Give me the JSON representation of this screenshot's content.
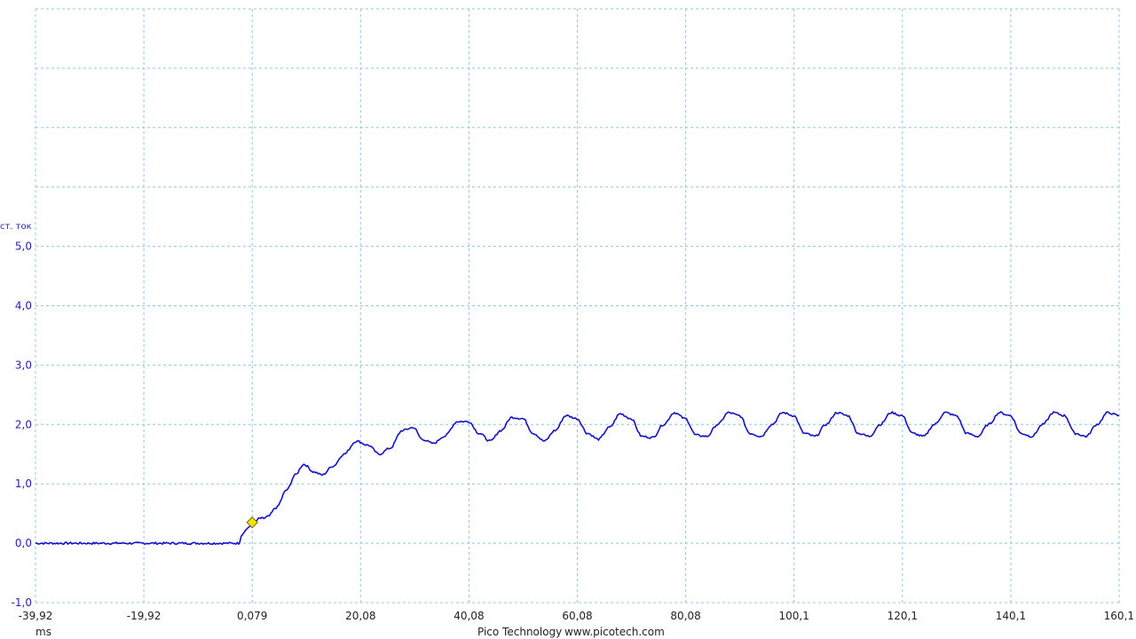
{
  "chart_data": {
    "type": "line",
    "x_unit": "ms",
    "y_label": "ст. ток",
    "x_ticks": [
      "-39,92",
      "-19,92",
      "0,079",
      "20,08",
      "40,08",
      "60,08",
      "80,08",
      "100,1",
      "120,1",
      "140,1",
      "160,1"
    ],
    "y_ticks": [
      "5,0",
      "4,0",
      "3,0",
      "2,0",
      "1,0",
      "0,0",
      "-1,0"
    ],
    "xlim": [
      -39.92,
      160.1
    ],
    "ylim": [
      -1.0,
      9.0
    ],
    "grid": true,
    "trigger_marker": {
      "x": 0.079,
      "y": 0.35
    },
    "series": [
      {
        "color": "#1212c8",
        "x": [
          -39.92,
          -25,
          -10,
          -2.4,
          -1.8,
          -0.8,
          0.4,
          1.5,
          2.2,
          3.0,
          4.5,
          6.5,
          8.0,
          9.6,
          11.5,
          13.0,
          15.0,
          17.0,
          19.3,
          21.5,
          23.5,
          25.5,
          27.8,
          29.8,
          31.5,
          33.5,
          35.5,
          38.0,
          40.0,
          42.0,
          44.0,
          46.0,
          48.0,
          50.0,
          52.0,
          54.0,
          56.0,
          58.0,
          60.0,
          62.0,
          64.0,
          66.0,
          68.0,
          70.0,
          72.0,
          74.0,
          76.0,
          78.0,
          80.0,
          82.0,
          84.0,
          86.0,
          88.0,
          90.0,
          92.0,
          94.0,
          96.0,
          98.0,
          100.0,
          102.0,
          104.0,
          106.0,
          108.0,
          110.0,
          112.0,
          114.0,
          116.0,
          118.0,
          120.0,
          122.0,
          124.0,
          126.0,
          128.0,
          130.0,
          132.0,
          134.0,
          136.0,
          138.0,
          140.0,
          142.0,
          144.0,
          146.0,
          148.0,
          150.0,
          152.0,
          154.0,
          156.0,
          158.0,
          160.1
        ],
        "y": [
          0.0,
          0.0,
          0.0,
          0.0,
          0.15,
          0.25,
          0.35,
          0.42,
          0.42,
          0.45,
          0.6,
          0.9,
          1.15,
          1.33,
          1.2,
          1.15,
          1.3,
          1.5,
          1.72,
          1.65,
          1.5,
          1.6,
          1.9,
          1.95,
          1.75,
          1.68,
          1.8,
          2.05,
          2.05,
          1.85,
          1.72,
          1.9,
          2.12,
          2.1,
          1.85,
          1.72,
          1.9,
          2.15,
          2.1,
          1.85,
          1.75,
          1.95,
          2.18,
          2.1,
          1.8,
          1.78,
          2.0,
          2.2,
          2.1,
          1.82,
          1.8,
          2.0,
          2.2,
          2.15,
          1.85,
          1.8,
          2.0,
          2.2,
          2.15,
          1.85,
          1.8,
          2.0,
          2.2,
          2.15,
          1.85,
          1.8,
          2.0,
          2.2,
          2.15,
          1.85,
          1.8,
          2.0,
          2.2,
          2.15,
          1.85,
          1.8,
          2.0,
          2.2,
          2.15,
          1.85,
          1.8,
          2.0,
          2.2,
          2.15,
          1.85,
          1.8,
          2.0,
          2.2,
          2.15
        ]
      }
    ]
  },
  "footer": {
    "brand": "Pico Technology",
    "url": "www.picotech.com"
  }
}
